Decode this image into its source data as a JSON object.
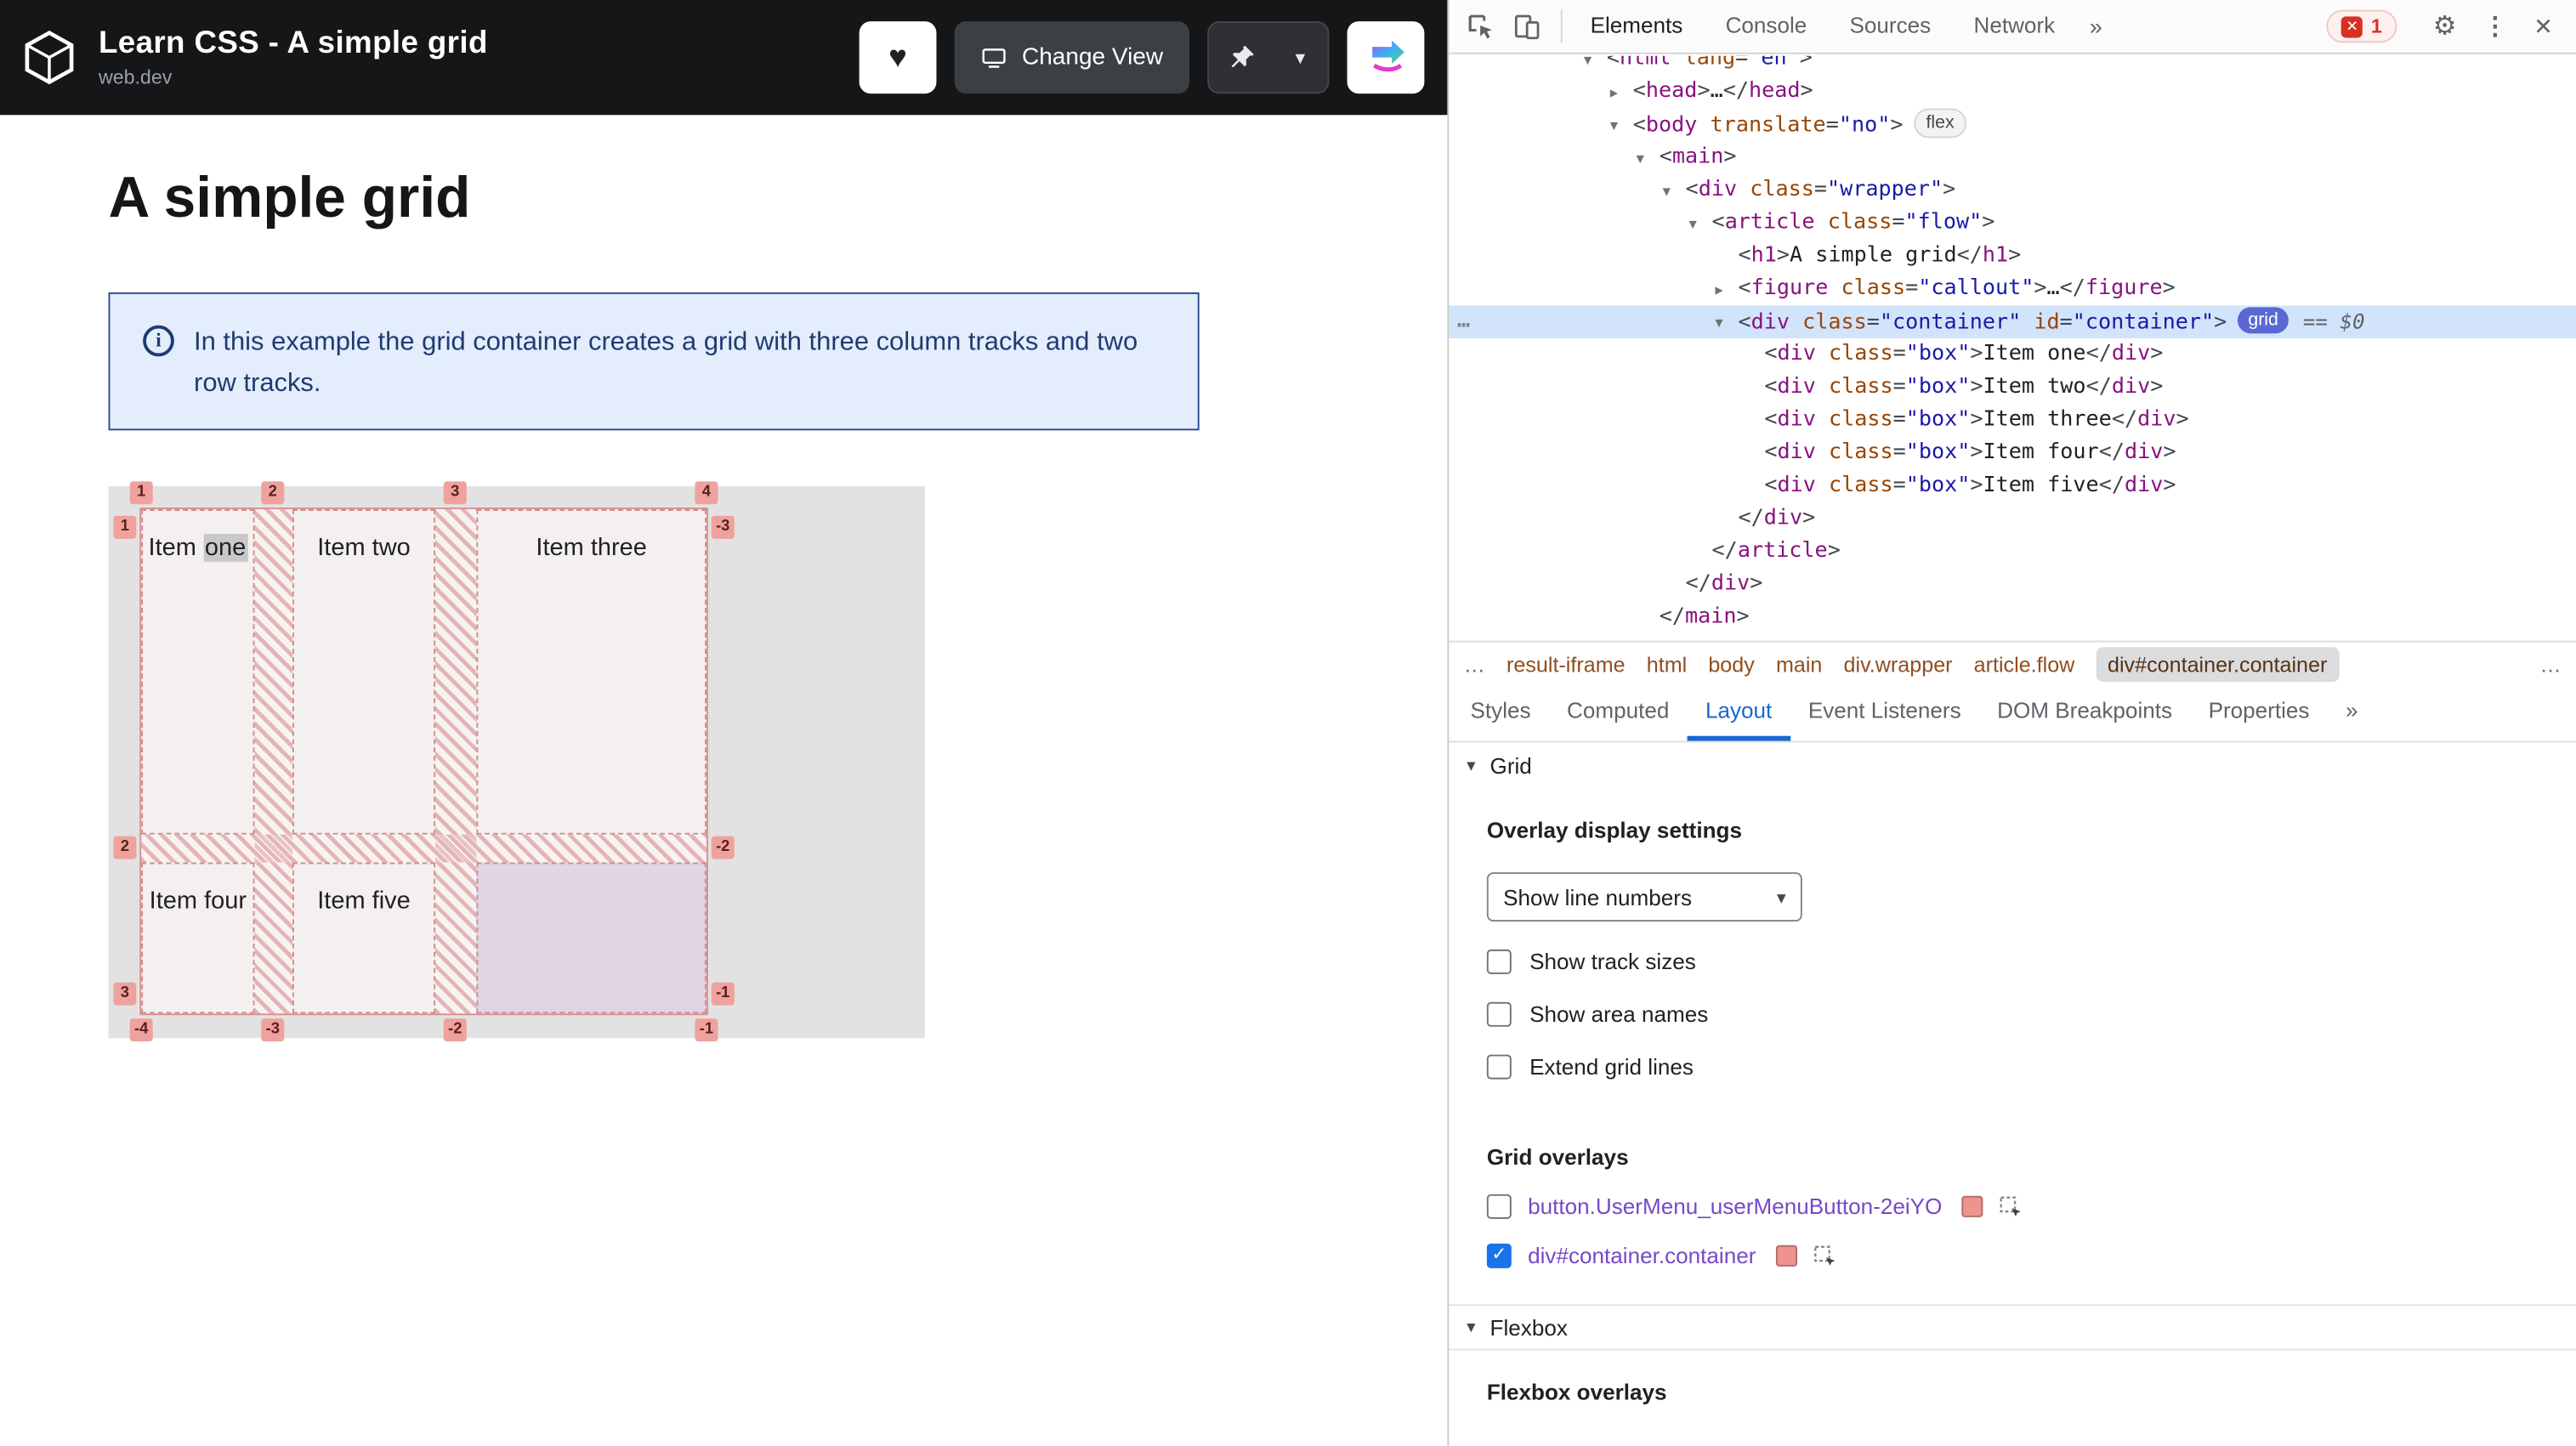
{
  "colors": {
    "accent_blue": "#1a73e8",
    "grid_badge": "#5968d3",
    "overlay_pink": "#ee938e",
    "callout_bg": "#e4edfc",
    "callout_border": "#2f4b8f",
    "callout_text": "#1f3b72"
  },
  "app": {
    "header": {
      "title": "Learn CSS - A simple grid",
      "subtitle": "web.dev",
      "change_view_label": "Change View"
    },
    "page": {
      "heading": "A simple grid",
      "callout": "In this example the grid container creates a grid with three column tracks and two row tracks."
    },
    "grid_demo": {
      "cells": [
        {
          "row": 0,
          "col": 0,
          "text": "Item one",
          "hl_word": "one"
        },
        {
          "row": 0,
          "col": 1,
          "text": "Item two"
        },
        {
          "row": 0,
          "col": 2,
          "text": "Item three"
        },
        {
          "row": 1,
          "col": 0,
          "text": "Item four"
        },
        {
          "row": 1,
          "col": 1,
          "text": "Item five"
        },
        {
          "row": 1,
          "col": 2,
          "text": "",
          "empty": true
        }
      ],
      "line_numbers": {
        "top": [
          "1",
          "2",
          "3",
          "4"
        ],
        "bottom": [
          "-4",
          "-3",
          "-2",
          "-1"
        ],
        "left": [
          "1",
          "2",
          "3"
        ],
        "right": [
          "-3",
          "-2",
          "-1"
        ]
      }
    }
  },
  "devtools": {
    "toolbar": {
      "tabs": [
        "Elements",
        "Console",
        "Sources",
        "Network"
      ],
      "active_tab": "Elements",
      "overflow": "»",
      "error_count": "1"
    },
    "tree": [
      {
        "i": 0,
        "ar": "d",
        "tk": [
          [
            "p",
            "<"
          ],
          [
            "t",
            "html"
          ],
          [
            "a",
            " lang"
          ],
          [
            "p",
            "="
          ],
          [
            "v",
            "\"en\""
          ],
          [
            "p",
            ">"
          ]
        ]
      },
      {
        "i": 1,
        "ar": "r",
        "tk": [
          [
            "p",
            "<"
          ],
          [
            "t",
            "head"
          ],
          [
            "p",
            ">"
          ],
          [
            "x",
            "…"
          ],
          [
            "p",
            "</"
          ],
          [
            "t",
            "head"
          ],
          [
            "p",
            ">"
          ]
        ]
      },
      {
        "i": 1,
        "ar": "d",
        "badge": "flex",
        "tk": [
          [
            "p",
            "<"
          ],
          [
            "t",
            "body"
          ],
          [
            "a",
            " translate"
          ],
          [
            "p",
            "="
          ],
          [
            "v",
            "\"no\""
          ],
          [
            "p",
            ">"
          ]
        ]
      },
      {
        "i": 2,
        "ar": "d",
        "tk": [
          [
            "p",
            "<"
          ],
          [
            "t",
            "main"
          ],
          [
            "p",
            ">"
          ]
        ]
      },
      {
        "i": 3,
        "ar": "d",
        "tk": [
          [
            "p",
            "<"
          ],
          [
            "t",
            "div"
          ],
          [
            "a",
            " class"
          ],
          [
            "p",
            "="
          ],
          [
            "v",
            "\"wrapper\""
          ],
          [
            "p",
            ">"
          ]
        ]
      },
      {
        "i": 4,
        "ar": "d",
        "tk": [
          [
            "p",
            "<"
          ],
          [
            "t",
            "article"
          ],
          [
            "a",
            " class"
          ],
          [
            "p",
            "="
          ],
          [
            "v",
            "\"flow\""
          ],
          [
            "p",
            ">"
          ]
        ]
      },
      {
        "i": 5,
        "tk": [
          [
            "p",
            "<"
          ],
          [
            "t",
            "h1"
          ],
          [
            "p",
            ">"
          ],
          [
            "x",
            "A simple grid"
          ],
          [
            "p",
            "</"
          ],
          [
            "t",
            "h1"
          ],
          [
            "p",
            ">"
          ]
        ]
      },
      {
        "i": 5,
        "ar": "r",
        "tk": [
          [
            "p",
            "<"
          ],
          [
            "t",
            "figure"
          ],
          [
            "a",
            " class"
          ],
          [
            "p",
            "="
          ],
          [
            "v",
            "\"callout\""
          ],
          [
            "p",
            ">"
          ],
          [
            "x",
            "…"
          ],
          [
            "p",
            "</"
          ],
          [
            "t",
            "figure"
          ],
          [
            "p",
            ">"
          ]
        ]
      },
      {
        "i": 5,
        "ar": "d",
        "sel": true,
        "gutter": "…",
        "badge": "grid",
        "note": "== $0",
        "tk": [
          [
            "p",
            "<"
          ],
          [
            "t",
            "div"
          ],
          [
            "a",
            " class"
          ],
          [
            "p",
            "="
          ],
          [
            "v",
            "\"container\""
          ],
          [
            "a",
            " id"
          ],
          [
            "p",
            "="
          ],
          [
            "v",
            "\"container\""
          ],
          [
            "p",
            ">"
          ]
        ]
      },
      {
        "i": 6,
        "tk": [
          [
            "p",
            "<"
          ],
          [
            "t",
            "div"
          ],
          [
            "a",
            " class"
          ],
          [
            "p",
            "="
          ],
          [
            "v",
            "\"box\""
          ],
          [
            "p",
            ">"
          ],
          [
            "x",
            "Item one"
          ],
          [
            "p",
            "</"
          ],
          [
            "t",
            "div"
          ],
          [
            "p",
            ">"
          ]
        ]
      },
      {
        "i": 6,
        "tk": [
          [
            "p",
            "<"
          ],
          [
            "t",
            "div"
          ],
          [
            "a",
            " class"
          ],
          [
            "p",
            "="
          ],
          [
            "v",
            "\"box\""
          ],
          [
            "p",
            ">"
          ],
          [
            "x",
            "Item two"
          ],
          [
            "p",
            "</"
          ],
          [
            "t",
            "div"
          ],
          [
            "p",
            ">"
          ]
        ]
      },
      {
        "i": 6,
        "tk": [
          [
            "p",
            "<"
          ],
          [
            "t",
            "div"
          ],
          [
            "a",
            " class"
          ],
          [
            "p",
            "="
          ],
          [
            "v",
            "\"box\""
          ],
          [
            "p",
            ">"
          ],
          [
            "x",
            "Item three"
          ],
          [
            "p",
            "</"
          ],
          [
            "t",
            "div"
          ],
          [
            "p",
            ">"
          ]
        ]
      },
      {
        "i": 6,
        "tk": [
          [
            "p",
            "<"
          ],
          [
            "t",
            "div"
          ],
          [
            "a",
            " class"
          ],
          [
            "p",
            "="
          ],
          [
            "v",
            "\"box\""
          ],
          [
            "p",
            ">"
          ],
          [
            "x",
            "Item four"
          ],
          [
            "p",
            "</"
          ],
          [
            "t",
            "div"
          ],
          [
            "p",
            ">"
          ]
        ]
      },
      {
        "i": 6,
        "tk": [
          [
            "p",
            "<"
          ],
          [
            "t",
            "div"
          ],
          [
            "a",
            " class"
          ],
          [
            "p",
            "="
          ],
          [
            "v",
            "\"box\""
          ],
          [
            "p",
            ">"
          ],
          [
            "x",
            "Item five"
          ],
          [
            "p",
            "</"
          ],
          [
            "t",
            "div"
          ],
          [
            "p",
            ">"
          ]
        ]
      },
      {
        "i": 5,
        "tk": [
          [
            "p",
            "</"
          ],
          [
            "t",
            "div"
          ],
          [
            "p",
            ">"
          ]
        ]
      },
      {
        "i": 4,
        "tk": [
          [
            "p",
            "</"
          ],
          [
            "t",
            "article"
          ],
          [
            "p",
            ">"
          ]
        ]
      },
      {
        "i": 3,
        "tk": [
          [
            "p",
            "</"
          ],
          [
            "t",
            "div"
          ],
          [
            "p",
            ">"
          ]
        ]
      },
      {
        "i": 2,
        "tk": [
          [
            "p",
            "</"
          ],
          [
            "t",
            "main"
          ],
          [
            "p",
            ">"
          ]
        ]
      }
    ],
    "breadcrumbs": {
      "overflow_left": "…",
      "items": [
        "result-iframe",
        "html",
        "body",
        "main",
        "div.wrapper",
        "article.flow",
        "div#container.container"
      ],
      "selected_index": 6,
      "overflow_right": "…"
    },
    "sidebar": {
      "tabs": [
        "Styles",
        "Computed",
        "Layout",
        "Event Listeners",
        "DOM Breakpoints",
        "Properties"
      ],
      "overflow": "»",
      "active_tab": "Layout"
    },
    "layout_pane": {
      "grid_section": "Grid",
      "overlay_settings_title": "Overlay display settings",
      "dropdown_value": "Show line numbers",
      "checkboxes": [
        "Show track sizes",
        "Show area names",
        "Extend grid lines"
      ],
      "grid_overlays_title": "Grid overlays",
      "overlays": [
        {
          "label": "button.UserMenu_userMenuButton-2eiYO",
          "checked": false
        },
        {
          "label": "div#container.container",
          "checked": true
        }
      ],
      "flexbox_section": "Flexbox",
      "flexbox_overlays_title": "Flexbox overlays"
    }
  }
}
